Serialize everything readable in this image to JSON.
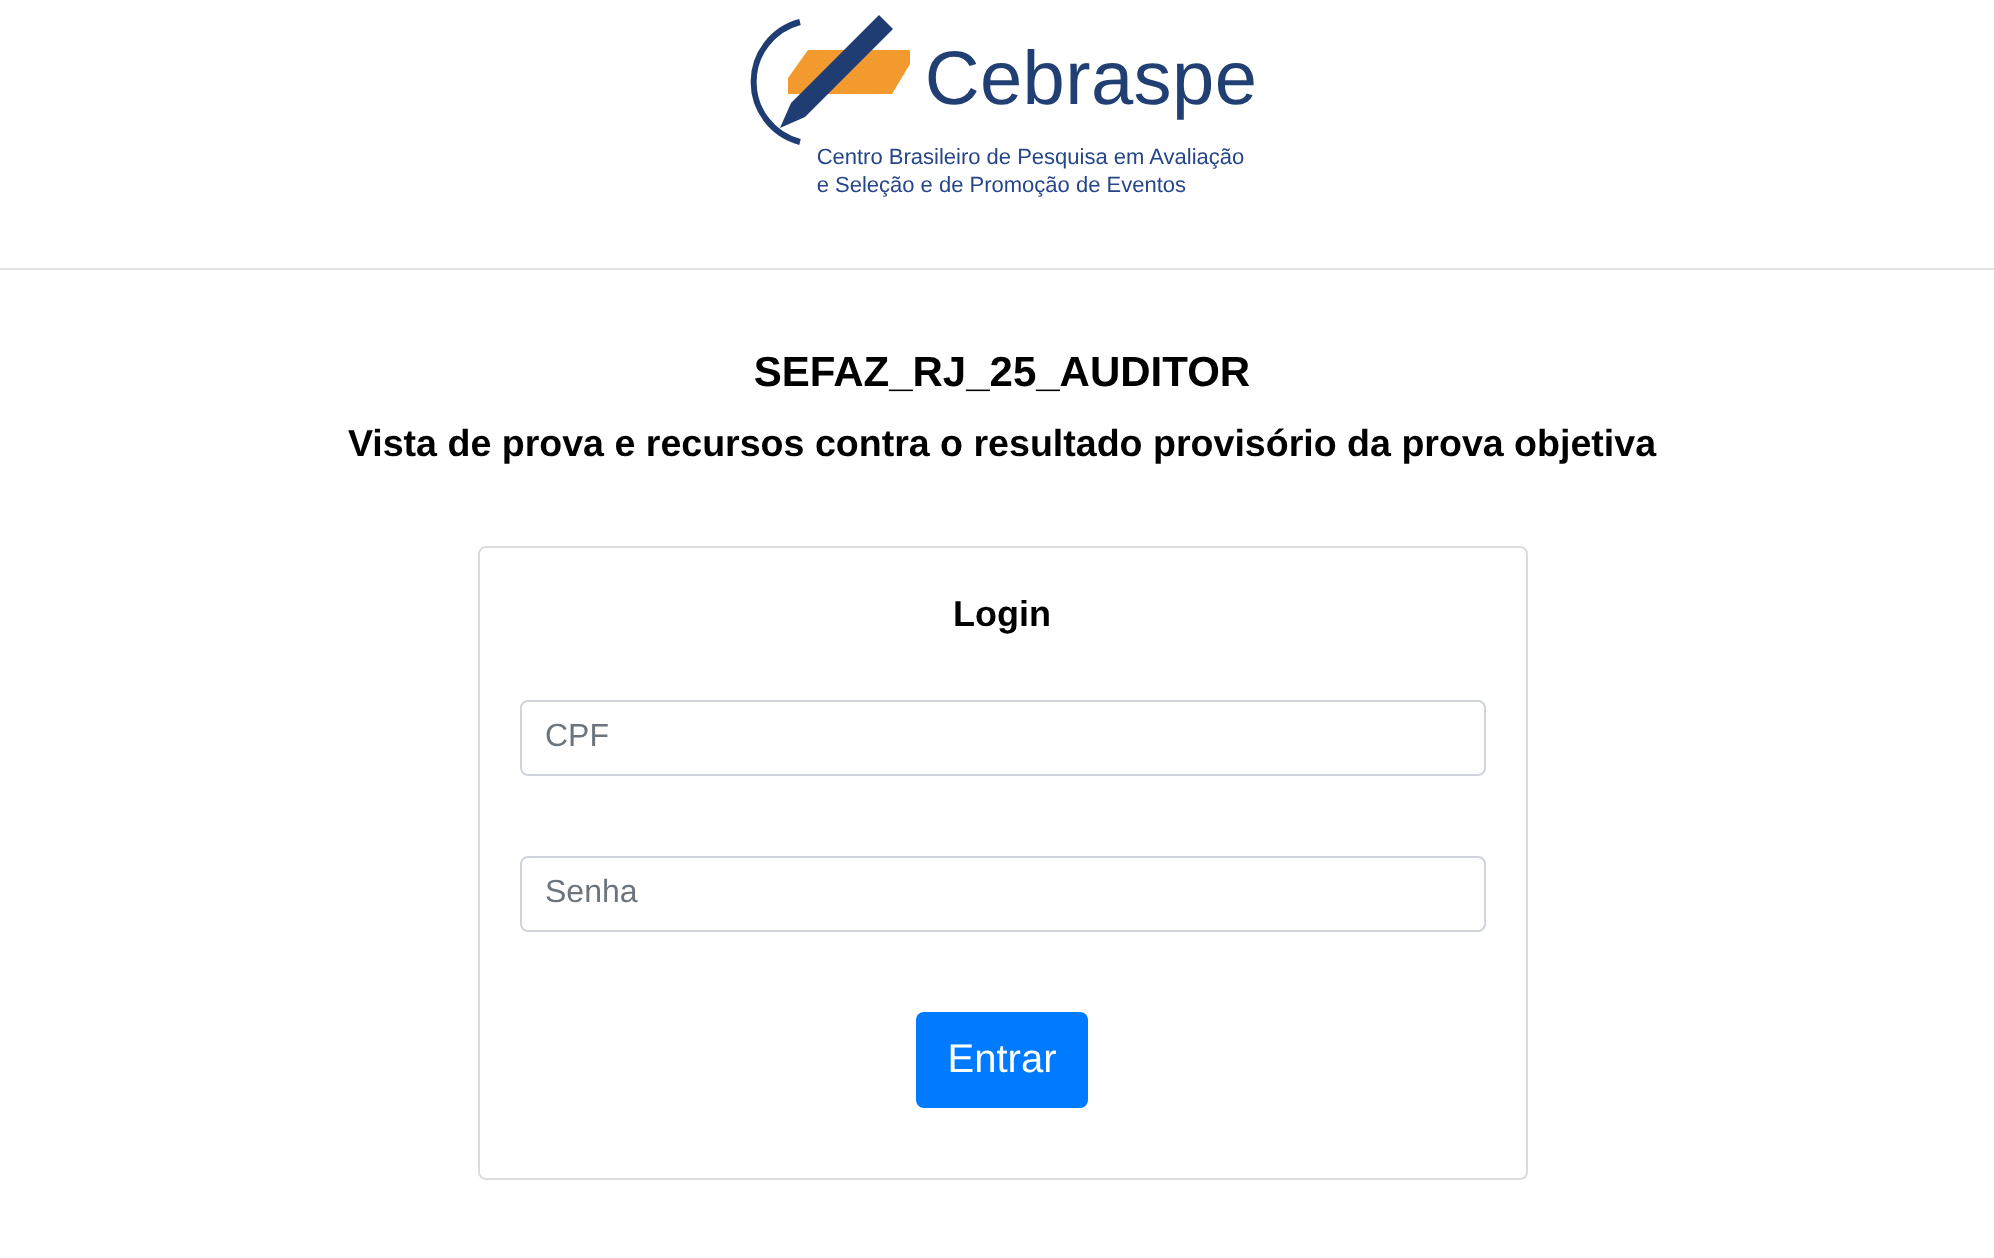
{
  "header": {
    "logo": {
      "name": "Cebraspe",
      "tagline": [
        "Centro Brasileiro de Pesquisa em Avaliação",
        "e Seleção e de Promoção de Eventos"
      ]
    }
  },
  "page": {
    "title": "SEFAZ_RJ_25_AUDITOR",
    "subtitle": "Vista de prova e recursos contra o resultado provisório da prova objetiva"
  },
  "login_form": {
    "title": "Login",
    "fields": [
      {
        "placeholder": "CPF"
      },
      {
        "placeholder": "Senha"
      }
    ],
    "submit_button": "Entrar"
  }
}
